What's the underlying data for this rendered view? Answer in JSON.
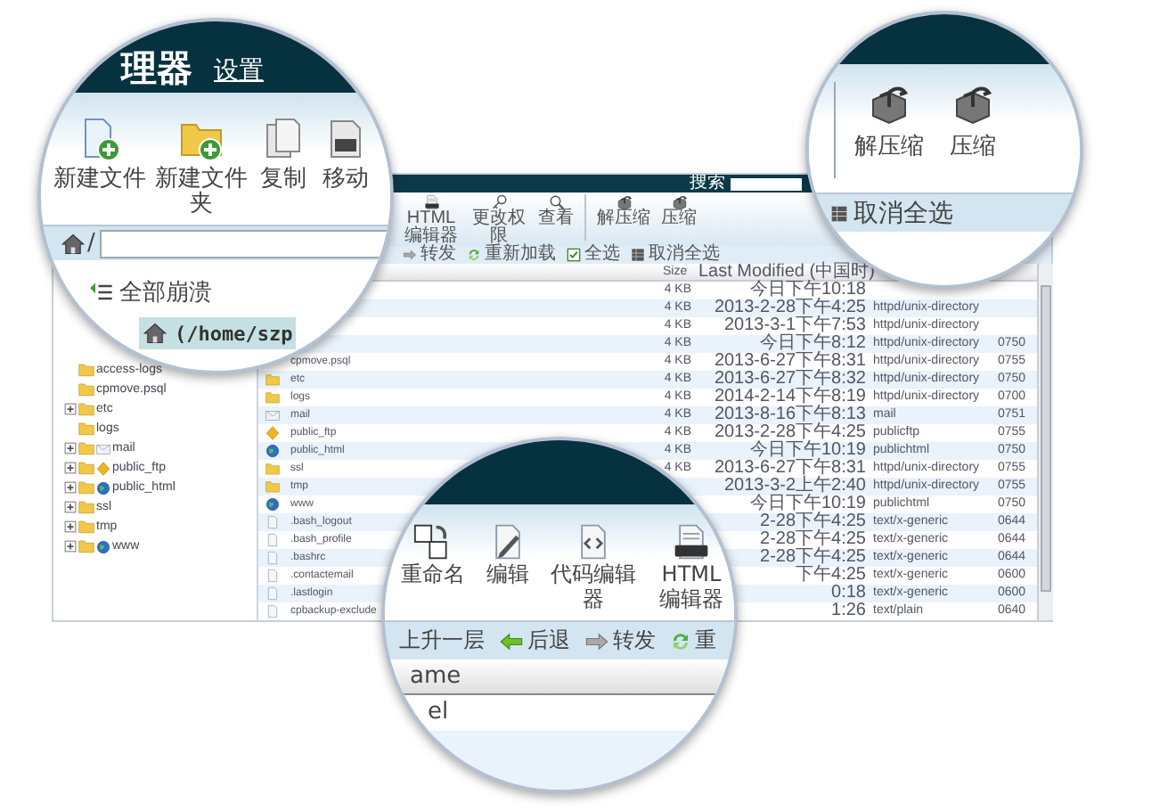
{
  "file_manager": {
    "search_label": "搜索",
    "toolbar": [
      {
        "kind": "button",
        "label": "HTML编辑器"
      },
      {
        "kind": "button",
        "label": "更改权限"
      },
      {
        "kind": "button",
        "label": "查看"
      },
      {
        "kind": "separator"
      },
      {
        "kind": "button",
        "label": "解压缩"
      },
      {
        "kind": "button",
        "label": "压缩"
      }
    ],
    "nav": [
      {
        "label": "转发"
      },
      {
        "label": "重新加载"
      },
      {
        "label": "全选"
      },
      {
        "label": "取消全选"
      }
    ],
    "tree": [
      {
        "kind": "folder",
        "name": "access-logs",
        "has_children": false
      },
      {
        "kind": "folder",
        "name": "cpmove.psql",
        "has_children": false
      },
      {
        "kind": "folder",
        "name": "etc",
        "has_children": true
      },
      {
        "kind": "folder",
        "name": "logs",
        "has_children": false
      },
      {
        "kind": "mail",
        "name": "mail",
        "has_children": true
      },
      {
        "kind": "ftp",
        "name": "public_ftp",
        "has_children": true
      },
      {
        "kind": "web",
        "name": "public_html",
        "has_children": true
      },
      {
        "kind": "folder",
        "name": "ssl",
        "has_children": true
      },
      {
        "kind": "folder",
        "name": "tmp",
        "has_children": true
      },
      {
        "kind": "web",
        "name": "www",
        "has_children": true
      }
    ],
    "table": {
      "columns": [
        "Size",
        "Last Modified (中国时)"
      ],
      "rows": [
        {
          "size": "4 KB",
          "modified": "今日下午10:18"
        },
        {
          "size": "4 KB",
          "modified": "2013-2-28下午4:25",
          "type": "httpd/unix-directory"
        },
        {
          "size": "4 KB",
          "modified": "2013-3-1下午7:53",
          "type": "httpd/unix-directory"
        },
        {
          "size": "4 KB",
          "modified": "今日下午8:12",
          "type": "httpd/unix-directory",
          "perms": "0750"
        },
        {
          "name": "cpmove.psql",
          "size": "4 KB",
          "modified": "2013-6-27下午8:31",
          "type": "httpd/unix-directory",
          "perms": "0755"
        },
        {
          "kind": "folder",
          "name": "etc",
          "size": "4 KB",
          "modified": "2013-6-27下午8:32",
          "type": "httpd/unix-directory",
          "perms": "0750"
        },
        {
          "kind": "folder",
          "name": "logs",
          "size": "4 KB",
          "modified": "2014-2-14下午8:19",
          "type": "httpd/unix-directory",
          "perms": "0700"
        },
        {
          "kind": "mail",
          "name": "mail",
          "size": "4 KB",
          "modified": "2013-8-16下午8:13",
          "type": "mail",
          "perms": "0751"
        },
        {
          "kind": "ftp",
          "name": "public_ftp",
          "size": "4 KB",
          "modified": "2013-2-28下午4:25",
          "type": "publicftp",
          "perms": "0755"
        },
        {
          "kind": "web",
          "name": "public_html",
          "size": "4 KB",
          "modified": "今日下午10:19",
          "type": "publichtml",
          "perms": "0750"
        },
        {
          "kind": "folder",
          "name": "ssl",
          "size": "4 KB",
          "modified": "2013-6-27下午8:31",
          "type": "httpd/unix-directory",
          "perms": "0755"
        },
        {
          "kind": "folder",
          "name": "tmp",
          "modified": "2013-3-2上午2:40",
          "type": "httpd/unix-directory",
          "perms": "0755"
        },
        {
          "kind": "web",
          "name": "www",
          "modified": "今日下午10:19",
          "type": "publichtml",
          "perms": "0750"
        },
        {
          "kind": "file",
          "name": ".bash_logout",
          "modified": "2-28下午4:25",
          "type": "text/x-generic",
          "perms": "0644"
        },
        {
          "kind": "file",
          "name": ".bash_profile",
          "modified": "2-28下午4:25",
          "type": "text/x-generic",
          "perms": "0644"
        },
        {
          "kind": "file",
          "name": ".bashrc",
          "modified": "2-28下午4:25",
          "type": "text/x-generic",
          "perms": "0644"
        },
        {
          "kind": "file",
          "name": ".contactemail",
          "modified": "下午4:25",
          "type": "text/x-generic",
          "perms": "0600"
        },
        {
          "kind": "file",
          "name": ".lastlogin",
          "modified": "0:18",
          "type": "text/x-generic",
          "perms": "0600"
        },
        {
          "kind": "file",
          "name": "cpbackup-exclude",
          "modified": "1:26",
          "type": "text/plain",
          "perms": "0640"
        }
      ]
    }
  },
  "lens_top_left": {
    "title": "理器",
    "settings_link": "设置",
    "toolbar": [
      {
        "label": "新建文件"
      },
      {
        "label": "新建文件夹"
      },
      {
        "label": "复制"
      },
      {
        "label": "移动"
      }
    ],
    "path_prefix": "/",
    "collapse_all": "全部崩溃",
    "current_folder": "(/home/szp"
  },
  "lens_top_right": {
    "toolbar": [
      {
        "label": "解压缩"
      },
      {
        "label": "压缩"
      }
    ],
    "deselect_all": "取消全选"
  },
  "lens_bottom": {
    "toolbar": [
      {
        "label": "重命名"
      },
      {
        "label": "编辑"
      },
      {
        "label": "代码编辑器"
      },
      {
        "label": "HTML编辑器"
      }
    ],
    "nav": [
      {
        "label": "上升一层"
      },
      {
        "label": "后退"
      },
      {
        "label": "转发"
      },
      {
        "label": "重"
      }
    ],
    "column_header": "ame",
    "row_text": "el"
  }
}
